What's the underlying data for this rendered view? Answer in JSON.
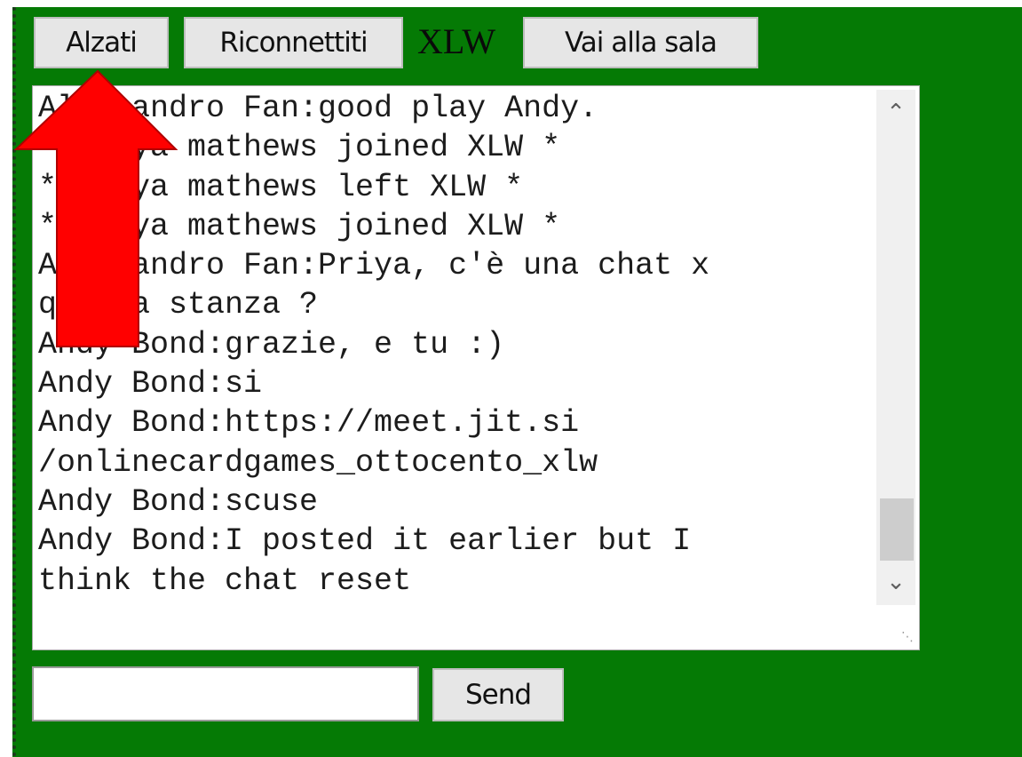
{
  "toolbar": {
    "stand_up_label": "Alzati",
    "reconnect_label": "Riconnettiti",
    "room_name": "XLW",
    "go_to_hall_label": "Vai alla sala"
  },
  "chat": {
    "lines": [
      "Alessandro Fan:good play Andy.",
      "* Priya mathews joined XLW *",
      "* Priya mathews left XLW *",
      "* Priya mathews joined XLW *",
      "Alessandro Fan:Priya, c'è una chat x",
      "questa stanza ?",
      "Andy Bond:grazie, e tu :)",
      "Andy Bond:si",
      "Andy Bond:https://meet.jit.si",
      "/onlinecardgames_ottocento_xlw",
      "Andy Bond:scuse",
      "Andy Bond:I posted it earlier but I",
      "think the chat reset"
    ],
    "scroll_up_icon": "chevron-up-icon",
    "scroll_down_icon": "chevron-down-icon"
  },
  "composer": {
    "input_value": "",
    "send_label": "Send"
  },
  "annotation": {
    "arrow_color": "#ff0000",
    "icon": "up-arrow-icon"
  },
  "colors": {
    "panel_green": "#057a05",
    "button_gray": "#e6e6e6"
  }
}
